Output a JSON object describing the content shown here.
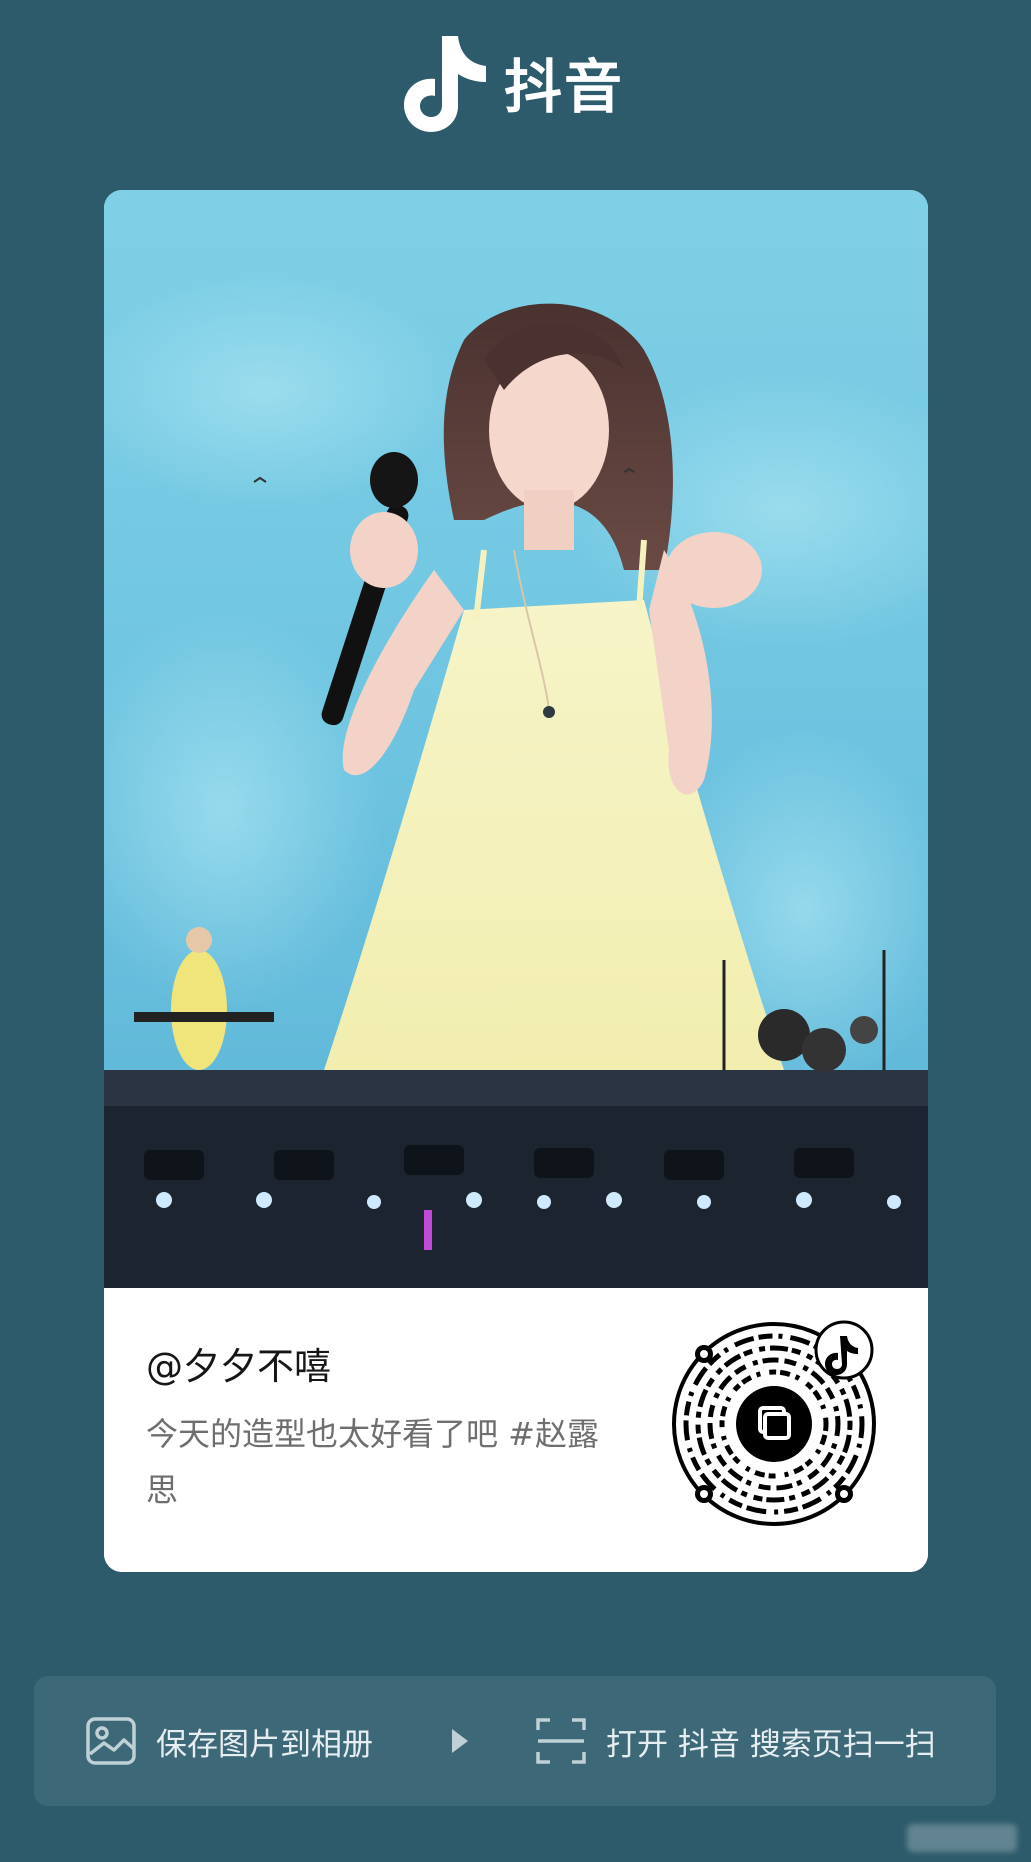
{
  "header": {
    "app_name": "抖音"
  },
  "post": {
    "username": "@夕夕不嘻",
    "description": "今天的造型也太好看了吧 #赵露思"
  },
  "actions": {
    "save_label": "保存图片到相册",
    "scan_label": "打开 抖音 搜索页扫一扫"
  },
  "icons": {
    "logo": "douyin-note-icon",
    "save": "image-icon",
    "arrow": "play-arrow-icon",
    "scan": "scan-frame-icon",
    "qr_badge": "douyin-note-icon"
  },
  "colors": {
    "background": "#2d5b6b",
    "bar": "#3d6877",
    "card": "#ffffff"
  }
}
